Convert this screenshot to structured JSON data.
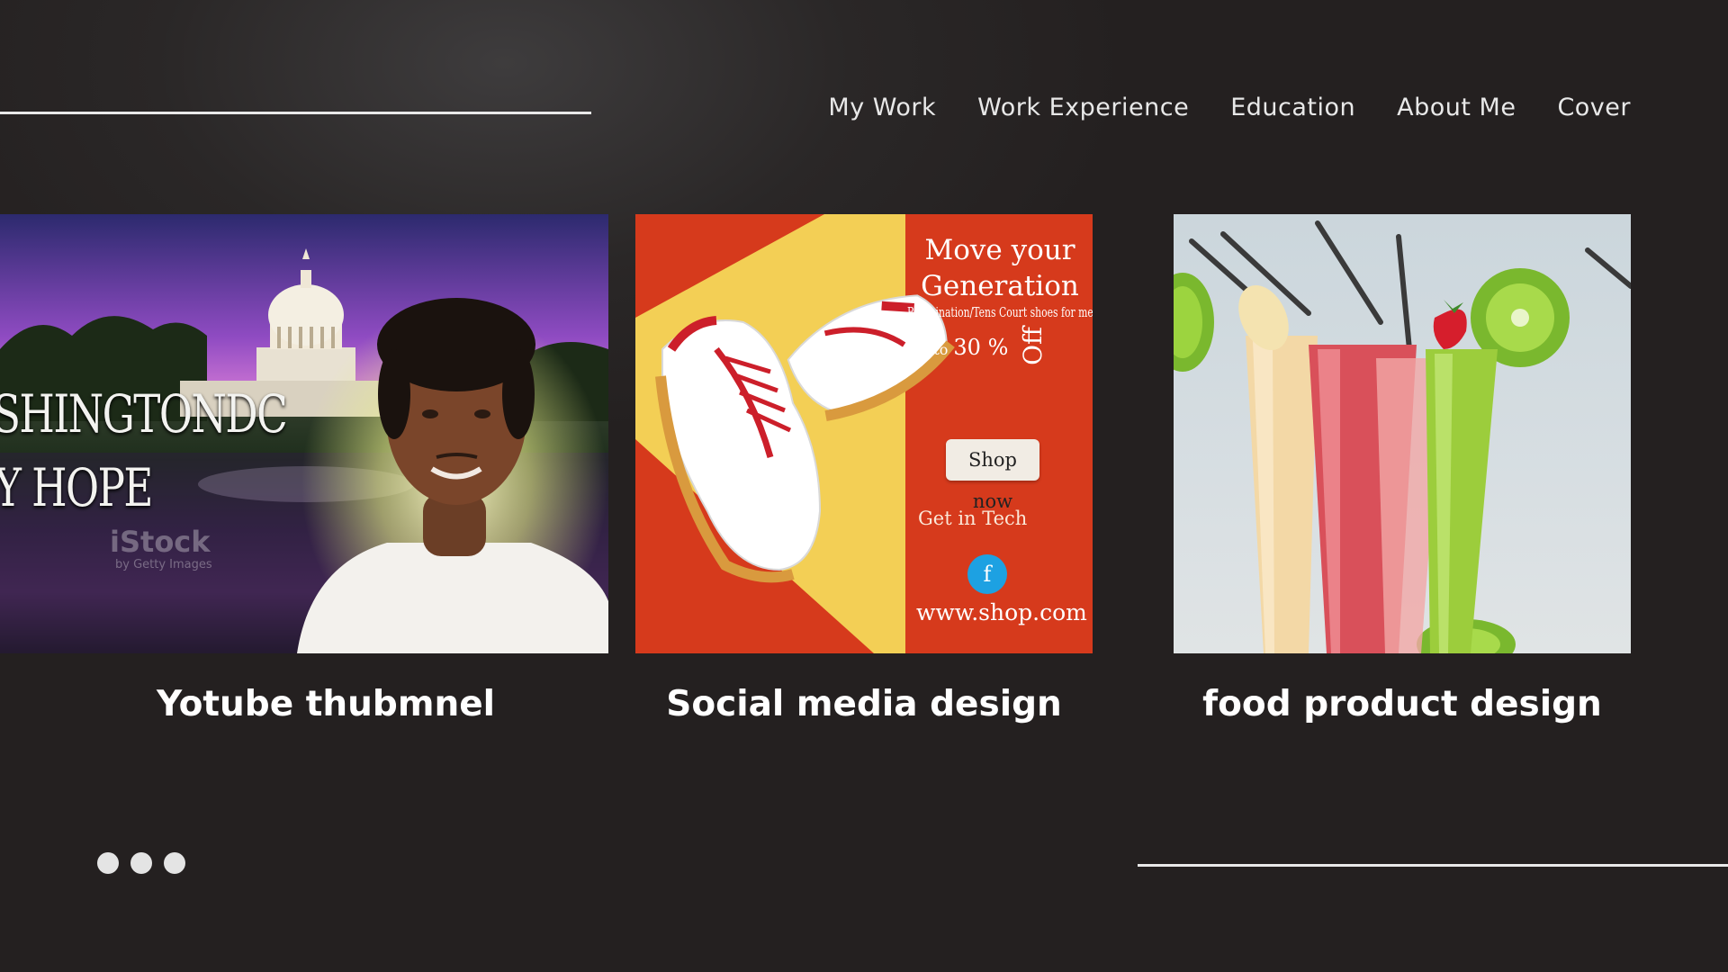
{
  "nav": {
    "items": [
      "My Work",
      "Work Experience",
      "Education",
      "About Me",
      "Cover"
    ]
  },
  "cards": [
    {
      "title": "Yotube thubmnel",
      "image": {
        "headline_1": "SHINGTONDC",
        "headline_2": "Y HOPE",
        "watermark": "iStock",
        "watermark_sub": "by Getty Images"
      }
    },
    {
      "title": "Social media design",
      "image": {
        "headline": [
          "Move your",
          "Generation"
        ],
        "subline": "Badmination/Tens Court shoes for men",
        "offer_prefix": "UP to",
        "offer_value": "30 %",
        "offer_suffix": "Off",
        "cta": "Shop now",
        "tagline": "Get in Tech",
        "social_icon": "f",
        "url": "www.shop.com"
      }
    },
    {
      "title": "food product design",
      "image": {}
    }
  ],
  "colors": {
    "background": "#262222",
    "rule": "#e9e9e9",
    "social_red": "#d63a1c",
    "social_yellow": "#f3cf55",
    "facebook_blue": "#1da1e2"
  }
}
